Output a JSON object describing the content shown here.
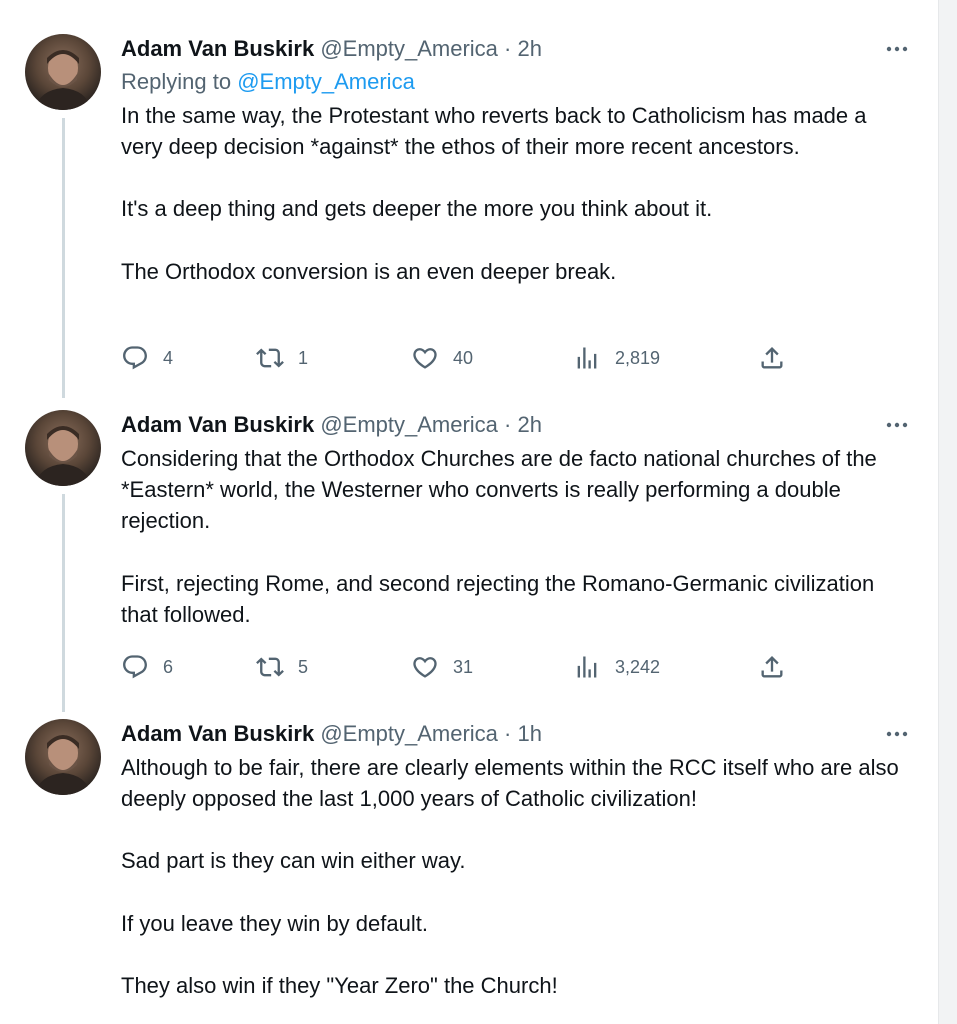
{
  "tweets": [
    {
      "author": "Adam Van Buskirk",
      "handle": "@Empty_America",
      "dot": "·",
      "time": "2h",
      "replying_prefix": "Replying to",
      "replying_to": "@Empty_America",
      "paragraphs": [
        "In the same way, the Protestant who reverts back to Catholicism has made a very deep decision *against* the ethos of their more recent ancestors.",
        "It's a deep thing and gets deeper the more you think about it.",
        "The Orthodox conversion is an even deeper break."
      ],
      "stats": {
        "replies": "4",
        "retweets": "1",
        "likes": "40",
        "views": "2,819"
      }
    },
    {
      "author": "Adam Van Buskirk",
      "handle": "@Empty_America",
      "dot": "·",
      "time": "2h",
      "paragraphs": [
        "Considering that the Orthodox Churches are de facto national churches of the *Eastern* world, the Westerner who converts is really performing a double rejection.",
        "First, rejecting Rome, and second rejecting the Romano-Germanic civilization that followed."
      ],
      "stats": {
        "replies": "6",
        "retweets": "5",
        "likes": "31",
        "views": "3,242"
      }
    },
    {
      "author": "Adam Van Buskirk",
      "handle": "@Empty_America",
      "dot": "·",
      "time": "1h",
      "paragraphs": [
        "Although to be fair, there are clearly elements within the RCC itself who are also deeply opposed the last 1,000 years of Catholic civilization!",
        "Sad part is they can win either way.",
        "If you leave they win by default.",
        "They also win if they \"Year Zero\" the Church!"
      ]
    }
  ],
  "icons": {
    "reply": "reply-icon",
    "retweet": "retweet-icon",
    "like": "heart-icon",
    "views": "views-icon",
    "share": "share-icon",
    "more": "more-icon"
  },
  "colors": {
    "text": "#0f1419",
    "secondary": "#536471",
    "link": "#1d9bf0",
    "thread_line": "#cfd9de"
  }
}
